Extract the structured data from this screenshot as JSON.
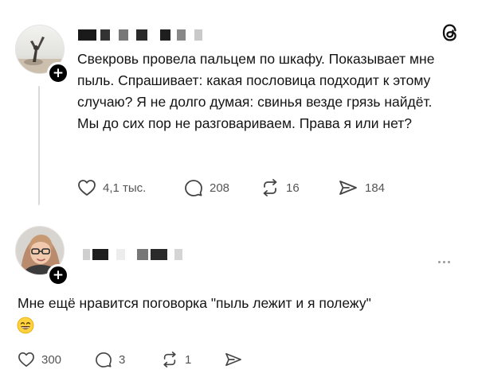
{
  "post": {
    "author": {
      "avatar_description": "figure on beach avatar",
      "name_blurred": true,
      "follow_label": "+"
    },
    "text": "Свекровь провела пальцем по шкафу. Показывает мне пыль. Спрашивает: какая пословица подходит к этому случаю? Я не долго думая: свинья везде грязь найдёт. Мы до сих пор не разговариваем. Права я или нет?",
    "actions": {
      "likes": "4,1 тыс.",
      "comments": "208",
      "reposts": "16",
      "shares": "184"
    },
    "icons": {
      "brand": "threads-logo-icon",
      "like": "heart-icon",
      "comment": "comment-icon",
      "repost": "repost-icon",
      "share": "send-icon"
    }
  },
  "reply": {
    "author": {
      "avatar_description": "woman with glasses avatar",
      "name_blurred": true,
      "follow_label": "+"
    },
    "text": "Мне ещё нравится поговорка \"пыль лежит и я полежу\"",
    "emoji": "😄",
    "actions": {
      "likes": "300",
      "comments": "3",
      "reposts": "1",
      "shares": ""
    }
  },
  "colors": {
    "text": "#141414",
    "muted": "#555555",
    "thread_line": "#d9d9d9",
    "badge": "#000000"
  }
}
